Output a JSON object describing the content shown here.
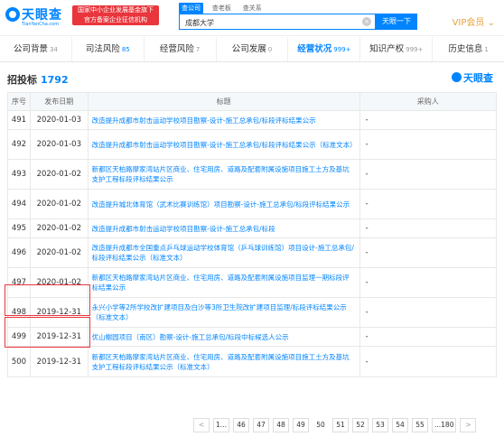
{
  "header": {
    "logo_text": "天眼查",
    "logo_sub": "TianYanCha.com",
    "badge_line1": "国家中小企业发展基金旗下",
    "badge_line2": "官方备案企业征信机构",
    "search_tabs": [
      "查公司",
      "查老板",
      "查关系"
    ],
    "search_value": "成都大学",
    "search_button": "天眼一下",
    "vip": "VIP会员"
  },
  "nav_tabs": [
    {
      "label": "公司背景",
      "count": "34"
    },
    {
      "label": "司法风险",
      "count": "85"
    },
    {
      "label": "经营风险",
      "count": "7"
    },
    {
      "label": "公司发展",
      "count": "0"
    },
    {
      "label": "经营状况",
      "count": "999+"
    },
    {
      "label": "知识产权",
      "count": "999+"
    },
    {
      "label": "历史信息",
      "count": "1"
    }
  ],
  "section": {
    "title": "招投标",
    "count": "1792",
    "brand": "天眼查"
  },
  "table": {
    "headers": [
      "序号",
      "发布日期",
      "标题",
      "采购人"
    ],
    "rows": [
      {
        "no": "491",
        "date": "2020-01-03",
        "title": "改造提升成都市射击运动学校项目勘察-设计-施工总承包/标段评标结果公示",
        "buyer": "-"
      },
      {
        "no": "492",
        "date": "2020-01-03",
        "title": "改造提升成都市射击运动学校项目勘察-设计-施工总承包/标段评标结果公示（标准文本）",
        "buyer": "-"
      },
      {
        "no": "493",
        "date": "2020-01-02",
        "title": "新都区天柏路摩家湾站片区商业、住宅用房、道路及配套附属设施项目施工土方及基坑支护工程标段评标结果公示",
        "buyer": "-"
      },
      {
        "no": "494",
        "date": "2020-01-02",
        "title": "改造提升城北体育馆（武术比赛训练馆）项目勘察-设计-施工总承包/标段评标结果公示",
        "buyer": "-"
      },
      {
        "no": "495",
        "date": "2020-01-02",
        "title": "改造提升成都市射击运动学校项目勘察-设计-施工总承包/标段",
        "buyer": "-"
      },
      {
        "no": "496",
        "date": "2020-01-02",
        "title": "改造提升成都市全国重点乒乓球运动学校体育馆（乒乓球训练馆）项目设计-施工总承包/标段评标结果公示（标准文本）",
        "buyer": "-"
      },
      {
        "no": "497",
        "date": "2020-01-02",
        "title": "新都区天柏路摩家湾站片区商业、住宅用房、道路及配套附属设施项目监理一期标段评标结果公示",
        "buyer": "-"
      },
      {
        "no": "498",
        "date": "2019-12-31",
        "title": "永兴小学等2所学校改扩建项目及白沙等3所卫生院改扩建项目监理/标段评标结果公示（标准文本）",
        "buyer": "-"
      },
      {
        "no": "499",
        "date": "2019-12-31",
        "title": "优山榭园项目（南区）勘察-设计-施工总承包/标段中标候选人公示",
        "buyer": "-"
      },
      {
        "no": "500",
        "date": "2019-12-31",
        "title": "新都区天柏路摩家湾站片区商业、住宅用房、道路及配套附属设施项目施工土方及基坑支护工程标段评标结果公示（标准文本）",
        "buyer": "-"
      }
    ]
  },
  "pagination": [
    "<",
    "1...",
    "46",
    "47",
    "48",
    "49",
    "50",
    "51",
    "52",
    "53",
    "54",
    "55",
    "...180",
    ">"
  ]
}
